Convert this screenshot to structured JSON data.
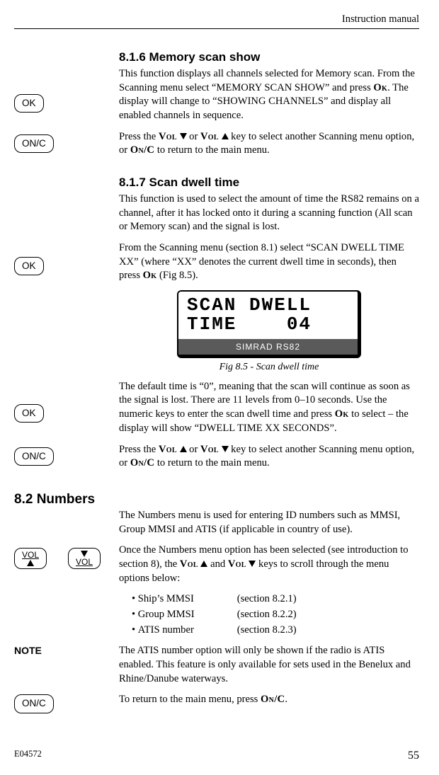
{
  "header": {
    "title": "Instruction manual"
  },
  "buttons": {
    "ok": "OK",
    "onc": "ON/C",
    "vol": "VOL"
  },
  "s816": {
    "heading": "8.1.6  Memory scan show",
    "p1a": "This function displays all channels selected for Memory scan. From the Scanning menu select “MEMORY SCAN SHOW” and press ",
    "p1b": ". The display will change to “SHOWING CHANNELS” and display all enabled channels in sequence.",
    "p2a": "Press the ",
    "p2b": " or ",
    "p2c": " key to select another Scanning menu option, or ",
    "p2d": " to return to the main menu."
  },
  "s817": {
    "heading": "8.1.7  Scan dwell time",
    "p1": "This function is used to select the amount of time the RS82 remains on a channel, after it has locked onto it during a scanning function (All scan or Memory scan) and the signal is lost.",
    "p2a": "From the Scanning menu (section 8.1) select “SCAN DWELL TIME XX” (where “XX” denotes the current dwell time in seconds), then press ",
    "p2b": " (Fig 8.5).",
    "lcd_line1": "SCAN DWELL",
    "lcd_line2": "TIME    04",
    "lcd_label": "SIMRAD RS82",
    "figcap": "Fig 8.5 - Scan dwell time",
    "p3a": "The default time is “0”, meaning that the scan will continue as soon as the signal is lost. There are 11 levels from 0–10 seconds. Use the numeric keys to enter the scan dwell time and press ",
    "p3b": " to select – the display will show “DWELL TIME XX SECONDS”.",
    "p4a": "Press the ",
    "p4b": " or ",
    "p4c": " key to select another Scanning menu option, or ",
    "p4d": " to return to the main menu."
  },
  "s82": {
    "heading": "8.2  Numbers",
    "p1": "The Numbers menu is used for entering ID numbers such as MMSI, Group MMSI and ATIS (if applicable in country of use).",
    "p2a": "Once the Numbers menu option has been selected (see introduction to section 8), the ",
    "p2b": " and ",
    "p2c": " keys to scroll through the menu options below:",
    "items": [
      {
        "name": "Ship’s MMSI",
        "ref": "(section 8.2.1)"
      },
      {
        "name": "Group MMSI",
        "ref": "(section 8.2.2)"
      },
      {
        "name": "ATIS number",
        "ref": "(section 8.2.3)"
      }
    ],
    "note_label": "NOTE",
    "note": "The ATIS number option will only be shown if the radio is ATIS enabled. This feature is only available for sets used in the Benelux and Rhine/Danube waterways.",
    "p3a": "To return to the main menu, press ",
    "p3b": "."
  },
  "inline": {
    "ok": "Ok",
    "onc": "On/C",
    "vol": "Vol"
  },
  "footer": {
    "doc": "E04572",
    "page": "55"
  }
}
